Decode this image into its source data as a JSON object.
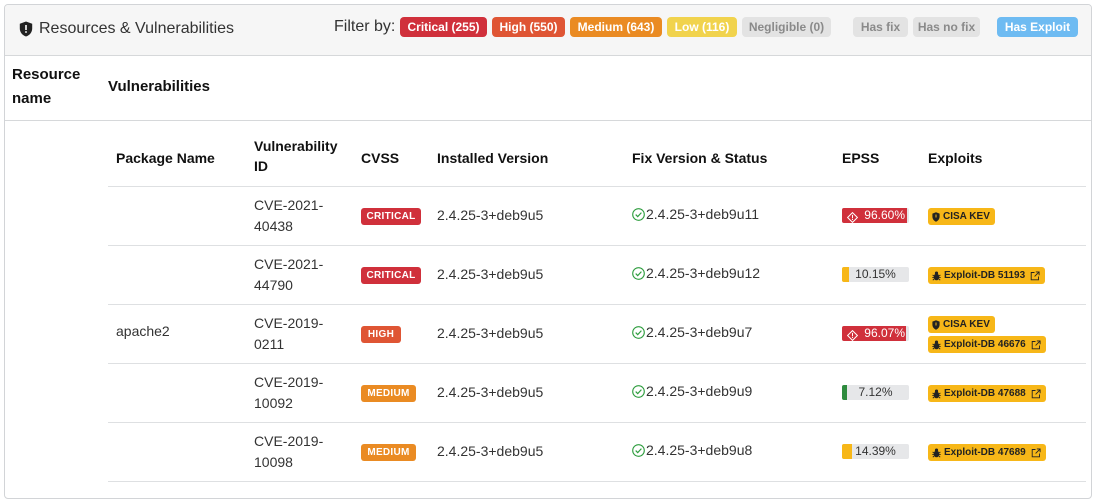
{
  "header": {
    "title": "Resources & Vulnerabilities",
    "filter_label": "Filter by:",
    "filters": {
      "critical": "Critical (255)",
      "high": "High (550)",
      "medium": "Medium (643)",
      "low": "Low (116)",
      "negligible": "Negligible (0)",
      "has_fix": "Has fix",
      "has_no_fix": "Has no fix",
      "has_exploit": "Has Exploit"
    }
  },
  "columns": {
    "resource_line1": "Resource",
    "resource_line2": "name",
    "vulnerabilities": "Vulnerabilities"
  },
  "table": {
    "headers": {
      "package": "Package Name",
      "vuln_line1": "Vulnerability",
      "vuln_line2": "ID",
      "cvss": "CVSS",
      "installed": "Installed Version",
      "fix": "Fix Version & Status",
      "epss": "EPSS",
      "exploits": "Exploits"
    },
    "package_name": "apache2",
    "rows": [
      {
        "id_line1": "CVE-2021-",
        "id_line2": "40438",
        "severity": "CRITICAL",
        "installed": "2.4.25-3+deb9u5",
        "fix": "2.4.25-3+deb9u11",
        "epss": "96.60%",
        "epss_value": 0.966,
        "exploits": [
          "CISA KEV"
        ]
      },
      {
        "id_line1": "CVE-2021-",
        "id_line2": "44790",
        "severity": "CRITICAL",
        "installed": "2.4.25-3+deb9u5",
        "fix": "2.4.25-3+deb9u12",
        "epss": "10.15%",
        "epss_value": 0.1015,
        "exploits": [
          "Exploit-DB 51193"
        ]
      },
      {
        "id_line1": "CVE-2019-",
        "id_line2": "0211",
        "severity": "HIGH",
        "installed": "2.4.25-3+deb9u5",
        "fix": "2.4.25-3+deb9u7",
        "epss": "96.07%",
        "epss_value": 0.9607,
        "exploits": [
          "CISA KEV",
          "Exploit-DB 46676"
        ]
      },
      {
        "id_line1": "CVE-2019-",
        "id_line2": "10092",
        "severity": "MEDIUM",
        "installed": "2.4.25-3+deb9u5",
        "fix": "2.4.25-3+deb9u9",
        "epss": "7.12%",
        "epss_value": 0.0712,
        "exploits": [
          "Exploit-DB 47688"
        ]
      },
      {
        "id_line1": "CVE-2019-",
        "id_line2": "10098",
        "severity": "MEDIUM",
        "installed": "2.4.25-3+deb9u5",
        "fix": "2.4.25-3+deb9u8",
        "epss": "14.39%",
        "epss_value": 0.1439,
        "exploits": [
          "Exploit-DB 47689"
        ]
      }
    ]
  },
  "colors": {
    "critical": "#d0303b",
    "high": "#df5534",
    "medium": "#ea8b23",
    "low": "#f1d34d",
    "exploit_badge": "#f7b718",
    "epss_high": "#d0303b",
    "epss_mid": "#f7b718",
    "epss_low": "#2e8b3e",
    "fix_ok": "#2e9d3e"
  },
  "icons": {
    "title": "shield-icon",
    "fix": "check-circle-icon",
    "epss_high": "diamond-warning-icon",
    "cisa": "shield-icon",
    "exploit_db": "bug-icon",
    "external": "external-link-icon"
  }
}
